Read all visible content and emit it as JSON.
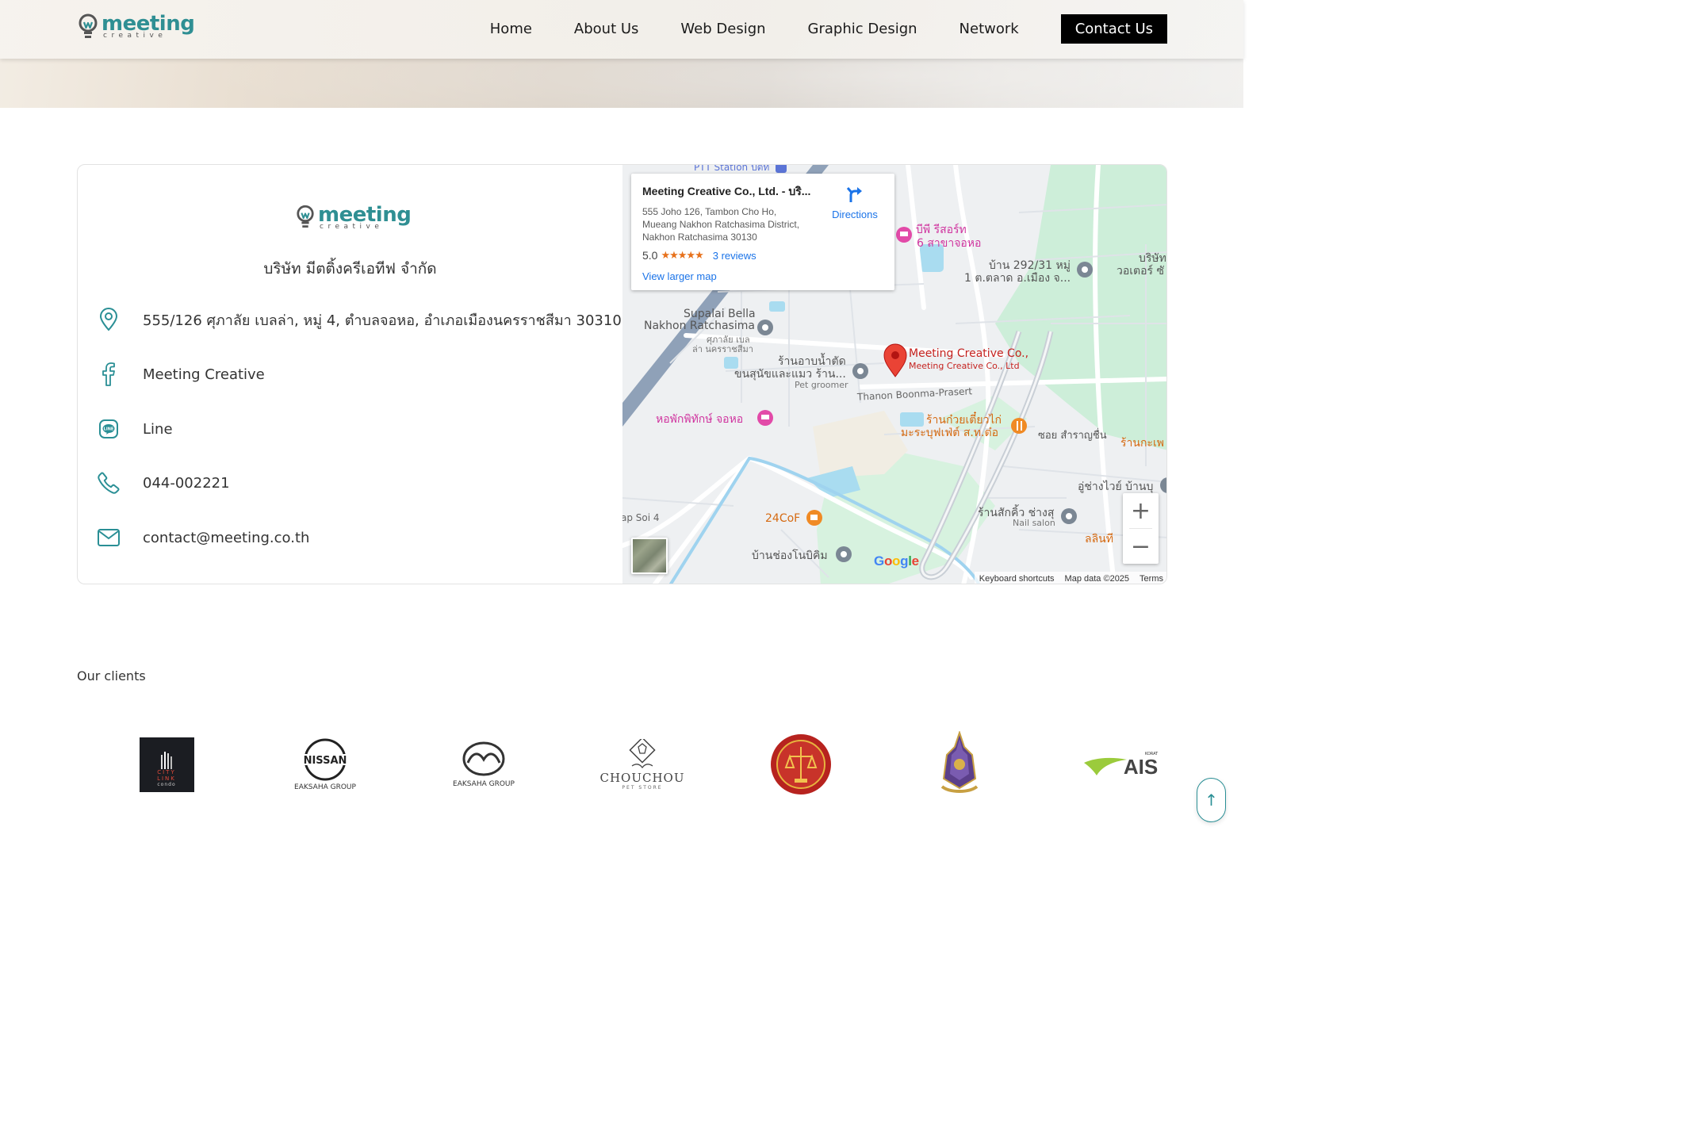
{
  "header": {
    "logo": {
      "word_main": "meeting",
      "word_sub": "creative",
      "icon": "lightbulb-logo-icon"
    },
    "nav": [
      {
        "label": "Home"
      },
      {
        "label": "About Us"
      },
      {
        "label": "Web Design"
      },
      {
        "label": "Graphic Design"
      },
      {
        "label": "Network"
      }
    ],
    "cta_label": "Contact Us"
  },
  "contact": {
    "company_name": "บริษัท มีตติ้งครีเอทีฟ จำกัด",
    "items": [
      {
        "icon": "location-pin-icon",
        "text": "555/126 ศุภาลัย เบลล่า, หมู่ 4, ตำบลจอหอ, อำเภอเมืองนครราชสีมา 30310"
      },
      {
        "icon": "facebook-icon",
        "text": "Meeting Creative"
      },
      {
        "icon": "line-icon",
        "text": "Line"
      },
      {
        "icon": "phone-icon",
        "text": "044-002221"
      },
      {
        "icon": "mail-icon",
        "text": "contact@meeting.co.th"
      }
    ]
  },
  "map": {
    "popup": {
      "title": "Meeting Creative Co., Ltd. - บริ...",
      "address_lines": [
        "555 Joho 126, Tambon Cho Ho,",
        "Mueang Nakhon Ratchasima District,",
        "Nakhon Ratchasima 30130"
      ],
      "rating": "5.0",
      "stars": "★★★★★",
      "reviews": "3 reviews",
      "larger_map": "View larger map",
      "directions": "Directions"
    },
    "labels": {
      "pin_title": "Meeting Creative Co.,",
      "pin_subtitle": "Meeting Creative Co., Ltd",
      "supalai_1": "Supalai Bella",
      "supalai_2": "Nakhon Ratchasima",
      "supalai_th1": "ศุภาลัย เบล",
      "supalai_th2": "ล่า นครราชสีมา",
      "petshop_1": "ร้านอาบน้ำตัด",
      "petshop_2": "ขนสุนัขและแมว ร้าน...",
      "pet_groomer": "Pet groomer",
      "road": "Thanon Boonma-Prasert",
      "dorm": "หอพักพิทักษ์ จอหอ",
      "noodle_1": "ร้านก๋วยเตี๋ยวไก่",
      "noodle_2": "มะระบุฟเฟ่ต์ ส.ท.ต๋อ",
      "soi": "ซอย สำราญชื่น",
      "shop_right": "ร้านกะเพ",
      "resort_1": "บีพี รีสอร์ท",
      "resort_2": "6 สาขาจอหอ",
      "house_1": "บ้าน 292/31 หมู่",
      "house_2": "1 ต.ตลาด อ.เมือง จ...",
      "company_right_1": "บริษัท",
      "company_right_2": "วอเตอร์ ซั",
      "mechanic": "อู่ช่างไวย์ บ้านบุ",
      "salon_1": "ร้านสักคิ้ว ช่างสุ",
      "salon_2": "Nail salon",
      "cafe": "24CoF",
      "lintee": "ลลินที",
      "house_bottom": "บ้านช่องโนบิคิม",
      "soi4": "ap Soi 4",
      "ptt": "PTT Station ปตท",
      "google": "Google"
    },
    "footer": [
      "Keyboard shortcuts",
      "Map data ©2025",
      "Terms"
    ],
    "zoom_in": "+",
    "zoom_out": "−"
  },
  "clients": {
    "title": "Our clients",
    "logos": [
      {
        "name": "City Link Condo",
        "lines": [
          "CITY",
          "LINK",
          "condo"
        ]
      },
      {
        "name": "Nissan",
        "wordmark": "NISSAN",
        "caption": "EAKSAHA GROUP"
      },
      {
        "name": "Mazda",
        "caption": "EAKSAHA GROUP"
      },
      {
        "name": "ChouChou",
        "wordmark": "CHOUCHOU",
        "caption": "PET STORE"
      },
      {
        "name": "Government seal red",
        "icon": "seal-icon"
      },
      {
        "name": "Royal emblem",
        "icon": "emblem-icon"
      },
      {
        "name": "AIS",
        "wordmark": "AIS",
        "caption": "KORAT"
      }
    ]
  },
  "back_to_top": "↑",
  "colors": {
    "accent": "#2a8f95",
    "cta_bg": "#000000",
    "map_link": "#1a73e8"
  }
}
